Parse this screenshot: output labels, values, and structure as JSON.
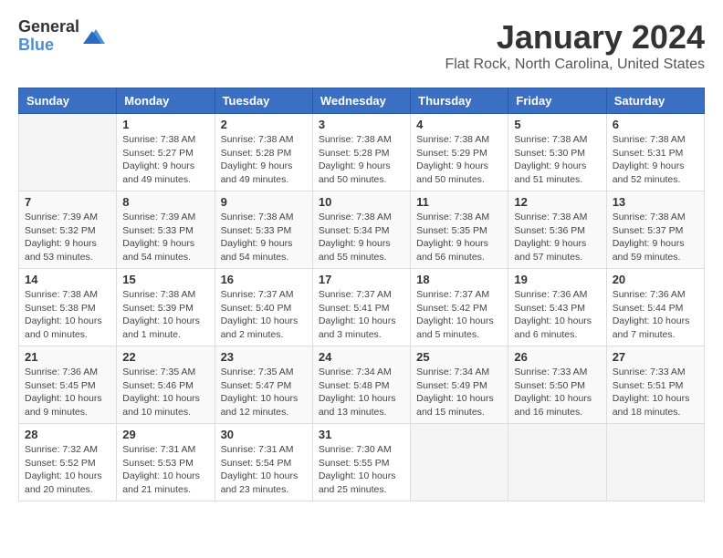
{
  "logo": {
    "general": "General",
    "blue": "Blue"
  },
  "title": "January 2024",
  "location": "Flat Rock, North Carolina, United States",
  "days_of_week": [
    "Sunday",
    "Monday",
    "Tuesday",
    "Wednesday",
    "Thursday",
    "Friday",
    "Saturday"
  ],
  "weeks": [
    [
      {
        "day": "",
        "info": ""
      },
      {
        "day": "1",
        "info": "Sunrise: 7:38 AM\nSunset: 5:27 PM\nDaylight: 9 hours\nand 49 minutes."
      },
      {
        "day": "2",
        "info": "Sunrise: 7:38 AM\nSunset: 5:28 PM\nDaylight: 9 hours\nand 49 minutes."
      },
      {
        "day": "3",
        "info": "Sunrise: 7:38 AM\nSunset: 5:28 PM\nDaylight: 9 hours\nand 50 minutes."
      },
      {
        "day": "4",
        "info": "Sunrise: 7:38 AM\nSunset: 5:29 PM\nDaylight: 9 hours\nand 50 minutes."
      },
      {
        "day": "5",
        "info": "Sunrise: 7:38 AM\nSunset: 5:30 PM\nDaylight: 9 hours\nand 51 minutes."
      },
      {
        "day": "6",
        "info": "Sunrise: 7:38 AM\nSunset: 5:31 PM\nDaylight: 9 hours\nand 52 minutes."
      }
    ],
    [
      {
        "day": "7",
        "info": "Sunrise: 7:39 AM\nSunset: 5:32 PM\nDaylight: 9 hours\nand 53 minutes."
      },
      {
        "day": "8",
        "info": "Sunrise: 7:39 AM\nSunset: 5:33 PM\nDaylight: 9 hours\nand 54 minutes."
      },
      {
        "day": "9",
        "info": "Sunrise: 7:38 AM\nSunset: 5:33 PM\nDaylight: 9 hours\nand 54 minutes."
      },
      {
        "day": "10",
        "info": "Sunrise: 7:38 AM\nSunset: 5:34 PM\nDaylight: 9 hours\nand 55 minutes."
      },
      {
        "day": "11",
        "info": "Sunrise: 7:38 AM\nSunset: 5:35 PM\nDaylight: 9 hours\nand 56 minutes."
      },
      {
        "day": "12",
        "info": "Sunrise: 7:38 AM\nSunset: 5:36 PM\nDaylight: 9 hours\nand 57 minutes."
      },
      {
        "day": "13",
        "info": "Sunrise: 7:38 AM\nSunset: 5:37 PM\nDaylight: 9 hours\nand 59 minutes."
      }
    ],
    [
      {
        "day": "14",
        "info": "Sunrise: 7:38 AM\nSunset: 5:38 PM\nDaylight: 10 hours\nand 0 minutes."
      },
      {
        "day": "15",
        "info": "Sunrise: 7:38 AM\nSunset: 5:39 PM\nDaylight: 10 hours\nand 1 minute."
      },
      {
        "day": "16",
        "info": "Sunrise: 7:37 AM\nSunset: 5:40 PM\nDaylight: 10 hours\nand 2 minutes."
      },
      {
        "day": "17",
        "info": "Sunrise: 7:37 AM\nSunset: 5:41 PM\nDaylight: 10 hours\nand 3 minutes."
      },
      {
        "day": "18",
        "info": "Sunrise: 7:37 AM\nSunset: 5:42 PM\nDaylight: 10 hours\nand 5 minutes."
      },
      {
        "day": "19",
        "info": "Sunrise: 7:36 AM\nSunset: 5:43 PM\nDaylight: 10 hours\nand 6 minutes."
      },
      {
        "day": "20",
        "info": "Sunrise: 7:36 AM\nSunset: 5:44 PM\nDaylight: 10 hours\nand 7 minutes."
      }
    ],
    [
      {
        "day": "21",
        "info": "Sunrise: 7:36 AM\nSunset: 5:45 PM\nDaylight: 10 hours\nand 9 minutes."
      },
      {
        "day": "22",
        "info": "Sunrise: 7:35 AM\nSunset: 5:46 PM\nDaylight: 10 hours\nand 10 minutes."
      },
      {
        "day": "23",
        "info": "Sunrise: 7:35 AM\nSunset: 5:47 PM\nDaylight: 10 hours\nand 12 minutes."
      },
      {
        "day": "24",
        "info": "Sunrise: 7:34 AM\nSunset: 5:48 PM\nDaylight: 10 hours\nand 13 minutes."
      },
      {
        "day": "25",
        "info": "Sunrise: 7:34 AM\nSunset: 5:49 PM\nDaylight: 10 hours\nand 15 minutes."
      },
      {
        "day": "26",
        "info": "Sunrise: 7:33 AM\nSunset: 5:50 PM\nDaylight: 10 hours\nand 16 minutes."
      },
      {
        "day": "27",
        "info": "Sunrise: 7:33 AM\nSunset: 5:51 PM\nDaylight: 10 hours\nand 18 minutes."
      }
    ],
    [
      {
        "day": "28",
        "info": "Sunrise: 7:32 AM\nSunset: 5:52 PM\nDaylight: 10 hours\nand 20 minutes."
      },
      {
        "day": "29",
        "info": "Sunrise: 7:31 AM\nSunset: 5:53 PM\nDaylight: 10 hours\nand 21 minutes."
      },
      {
        "day": "30",
        "info": "Sunrise: 7:31 AM\nSunset: 5:54 PM\nDaylight: 10 hours\nand 23 minutes."
      },
      {
        "day": "31",
        "info": "Sunrise: 7:30 AM\nSunset: 5:55 PM\nDaylight: 10 hours\nand 25 minutes."
      },
      {
        "day": "",
        "info": ""
      },
      {
        "day": "",
        "info": ""
      },
      {
        "day": "",
        "info": ""
      }
    ]
  ]
}
